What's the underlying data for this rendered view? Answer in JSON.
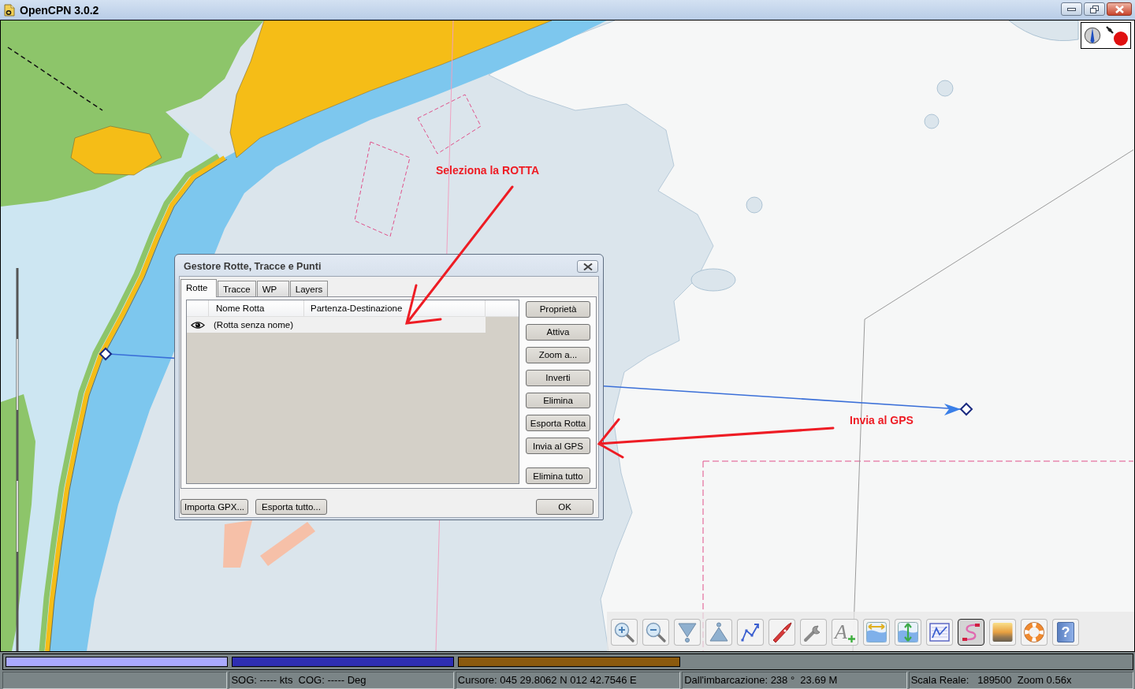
{
  "window": {
    "title": "OpenCPN 3.0.2"
  },
  "status_icons": {
    "gps_fix": false
  },
  "annotations": {
    "select_route": "Seleziona la ROTTA",
    "send_to_gps": "Invia al GPS"
  },
  "route_manager": {
    "title": "Gestore Rotte, Tracce e Punti",
    "tabs": [
      {
        "label": "Rotte",
        "selected": true
      },
      {
        "label": "Tracce",
        "selected": false
      },
      {
        "label": "WP",
        "selected": false
      },
      {
        "label": "Layers",
        "selected": false
      }
    ],
    "columns": [
      "Nome Rotta",
      "Partenza-Destinazione"
    ],
    "rows": [
      {
        "visible": true,
        "selected": false,
        "name": "(Rotta senza nome)"
      }
    ],
    "actions": [
      "Proprietà",
      "Attiva",
      "Zoom a...",
      "Inverti",
      "Elimina",
      "Esporta Rotta",
      "Invia al GPS"
    ],
    "delete_all": "Elimina tutto",
    "footer_buttons": [
      "Importa GPX...",
      "Esporta tutto..."
    ],
    "ok": "OK"
  },
  "toolbar": {
    "tools": [
      {
        "kind": "zoom_in",
        "selected": false
      },
      {
        "kind": "zoom_out",
        "selected": false
      },
      {
        "kind": "scale_down",
        "selected": false
      },
      {
        "kind": "scale_up",
        "selected": false
      },
      {
        "kind": "route",
        "selected": false
      },
      {
        "kind": "follow",
        "selected": false
      },
      {
        "kind": "settings",
        "selected": false
      },
      {
        "kind": "text",
        "glyph": "A",
        "selected": false
      },
      {
        "kind": "tide",
        "selected": false
      },
      {
        "kind": "current",
        "selected": false
      },
      {
        "kind": "print",
        "selected": false
      },
      {
        "kind": "route_manager",
        "selected": true
      },
      {
        "kind": "color_scheme",
        "selected": false
      },
      {
        "kind": "mob",
        "selected": false
      },
      {
        "kind": "help",
        "glyph": "?",
        "selected": false
      }
    ]
  },
  "chart_bar": [
    {
      "color": "#aaaaff"
    },
    {
      "color": "#2e2eb2"
    },
    {
      "color": "#8b5a0e"
    }
  ],
  "status_bar": [
    "SOG: ----- kts  COG: ----- Deg",
    "Cursore: 045 29.8062 N 012 42.7546 E",
    "Dall'imbarcazione: 238 °  23.69 M",
    "Scala Reale:   189500  Zoom 0.56x"
  ]
}
